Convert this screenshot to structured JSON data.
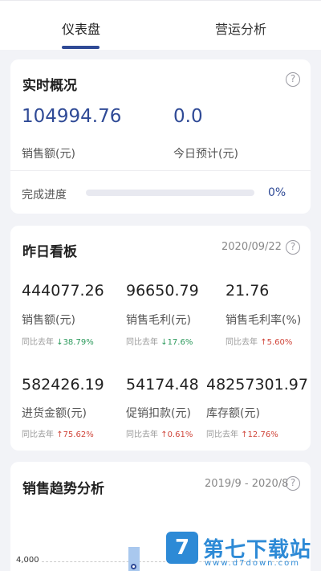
{
  "tabs": [
    {
      "label": "仪表盘",
      "active": true
    },
    {
      "label": "营运分析",
      "active": false
    }
  ],
  "realtime": {
    "title": "实时概况",
    "help": "?",
    "sales_value": "104994.76",
    "sales_label": "销售额(元)",
    "forecast_value": "0.0",
    "forecast_label": "今日预计(元)",
    "progress_label": "完成进度",
    "progress_percent": 0,
    "progress_text": "0%"
  },
  "yesterday": {
    "title": "昨日看板",
    "date": "2020/09/22",
    "help": "?",
    "metrics": [
      {
        "value": "444077.26",
        "label": "销售额(元)",
        "cmp_prefix": "同比去年",
        "cmp": "↓38.79%",
        "trend": "down"
      },
      {
        "value": "96650.79",
        "label": "销售毛利(元)",
        "cmp_prefix": "同比去年",
        "cmp": "↓17.6%",
        "trend": "down"
      },
      {
        "value": "21.76",
        "label": "销售毛利率(%)",
        "cmp_prefix": "同比去年",
        "cmp": "↑5.60%",
        "trend": "up"
      },
      {
        "value": "582426.19",
        "label": "进货金额(元)",
        "cmp_prefix": "同比去年",
        "cmp": "↑75.62%",
        "trend": "up"
      },
      {
        "value": "54174.48",
        "label": "促销扣款(元)",
        "cmp_prefix": "同比去年",
        "cmp": "↑0.61%",
        "trend": "up"
      },
      {
        "value": "48257301.97",
        "label": "库存额(元)",
        "cmp_prefix": "同比去年",
        "cmp": "↑12.76%",
        "trend": "up"
      }
    ]
  },
  "trend": {
    "title": "销售趋势分析",
    "range": "2019/9 - 2020/8",
    "help": "?",
    "y_tick": "4,000"
  },
  "watermark": {
    "logo": "7",
    "name": "第七下载站",
    "url": "www.d7down.com"
  },
  "colors": {
    "accent": "#2f4a96",
    "up": "#d0453a",
    "down": "#2c9a5c"
  }
}
